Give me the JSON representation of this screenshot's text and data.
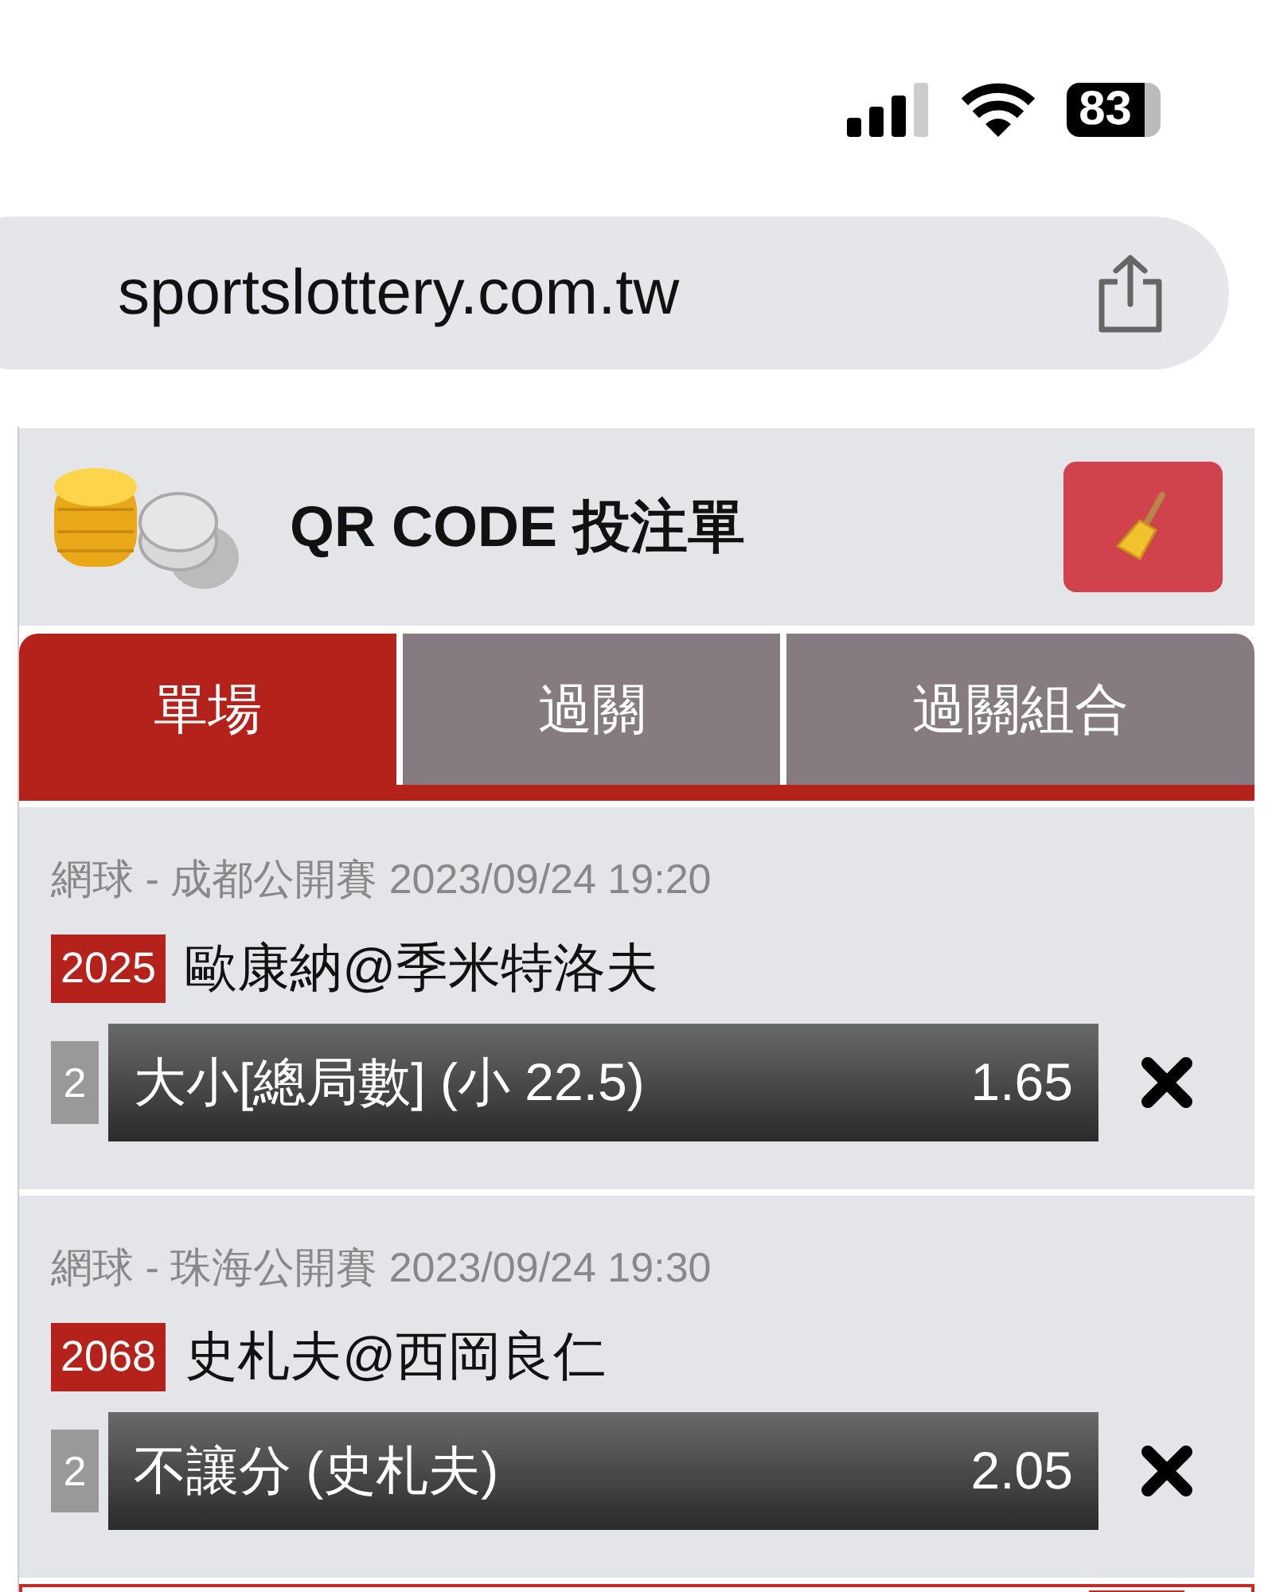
{
  "status_bar": {
    "battery": "83"
  },
  "browser": {
    "url": "sportslottery.com.tw"
  },
  "header": {
    "title": "QR CODE 投注單"
  },
  "tabs": [
    {
      "label": "單場",
      "selected": true
    },
    {
      "label": "過關",
      "selected": false
    },
    {
      "label": "過關組合",
      "selected": false
    }
  ],
  "bets": [
    {
      "event": "網球 - 成都公開賽 2023/09/24 19:20",
      "number": "2025",
      "match": "歐康納@季米特洛夫",
      "count": "2",
      "selection": "大小[總局數] (小 22.5)",
      "odds": "1.65"
    },
    {
      "event": "網球 - 珠海公開賽 2023/09/24 19:30",
      "number": "2068",
      "match": "史札夫@西岡良仁",
      "count": "2",
      "selection": "不讓分 (史札夫)",
      "odds": "2.05"
    }
  ]
}
